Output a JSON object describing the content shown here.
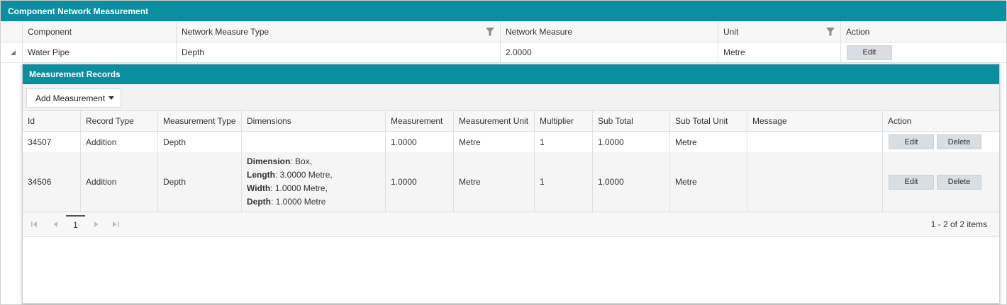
{
  "main_grid": {
    "title": "Component Network Measurement",
    "columns": [
      "Component",
      "Network Measure Type",
      "Network Measure",
      "Unit",
      "Action"
    ],
    "row": {
      "component": "Water Pipe",
      "measure_type": "Depth",
      "measure": "2.0000",
      "unit": "Metre",
      "action_edit": "Edit"
    }
  },
  "detail": {
    "title": "Measurement Records",
    "add_button": "Add Measurement",
    "columns": [
      "Id",
      "Record Type",
      "Measurement Type",
      "Dimensions",
      "Measurement",
      "Measurement Unit",
      "Multiplier",
      "Sub Total",
      "Sub Total Unit",
      "Message",
      "Action"
    ],
    "rows": [
      {
        "id": "34507",
        "record_type": "Addition",
        "measurement_type": "Depth",
        "dimensions": [],
        "measurement": "1.0000",
        "measurement_unit": "Metre",
        "multiplier": "1",
        "sub_total": "1.0000",
        "sub_total_unit": "Metre",
        "message": "",
        "edit": "Edit",
        "delete": "Delete"
      },
      {
        "id": "34506",
        "record_type": "Addition",
        "measurement_type": "Depth",
        "dimensions": [
          {
            "label": "Dimension",
            "value": ": Box,"
          },
          {
            "label": "Length",
            "value": ": 3.0000 Metre,"
          },
          {
            "label": "Width",
            "value": ": 1.0000 Metre,"
          },
          {
            "label": "Depth",
            "value": ": 1.0000 Metre"
          }
        ],
        "measurement": "1.0000",
        "measurement_unit": "Metre",
        "multiplier": "1",
        "sub_total": "1.0000",
        "sub_total_unit": "Metre",
        "message": "",
        "edit": "Edit",
        "delete": "Delete"
      }
    ],
    "pager": {
      "current_page": "1",
      "info": "1 - 2 of 2 items"
    }
  },
  "colors": {
    "header_bar": "#0a8ea0",
    "button_bg": "#d9dee3"
  },
  "icons": [
    "filter-icon",
    "expand-collapse-icon",
    "caret-down-icon",
    "first-page-icon",
    "prev-page-icon",
    "next-page-icon",
    "last-page-icon"
  ]
}
